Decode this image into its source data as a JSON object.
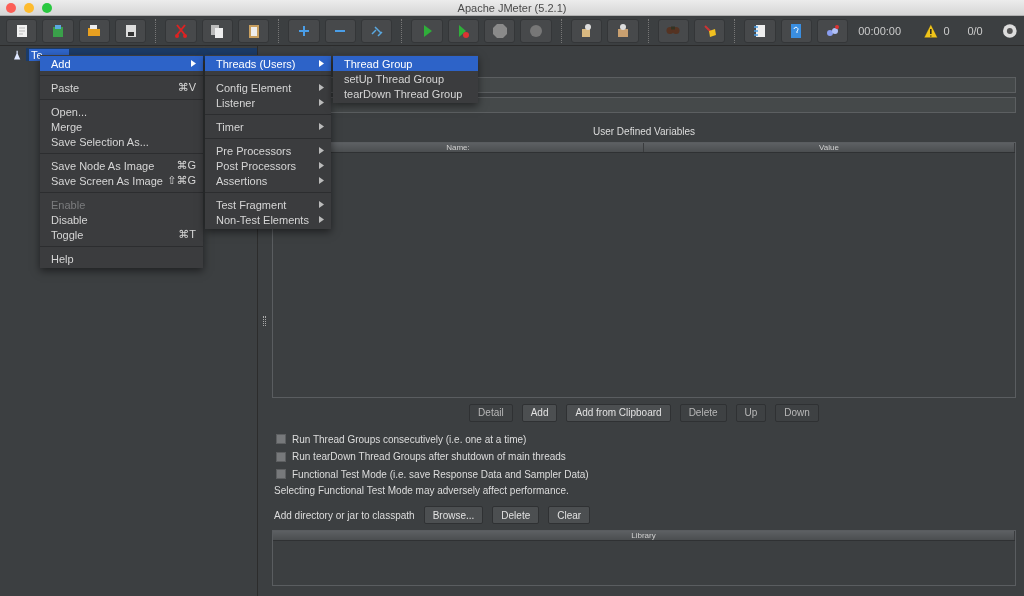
{
  "window": {
    "title": "Apache JMeter (5.2.1)"
  },
  "toolbar": {
    "timer": "00:00:00",
    "warnings": "0",
    "threads": "0/0"
  },
  "tree": {
    "items": [
      {
        "label": "Te",
        "selected": true
      }
    ]
  },
  "context_menu": {
    "sections": [
      {
        "items": [
          {
            "label": "Add",
            "submenu": true,
            "selected": true,
            "disabled": false
          }
        ]
      },
      {
        "items": [
          {
            "label": "Paste",
            "shortcut": "⌘V",
            "submenu": false,
            "selected": false,
            "disabled": false
          }
        ]
      },
      {
        "items": [
          {
            "label": "Open...",
            "submenu": false,
            "selected": false,
            "disabled": false
          },
          {
            "label": "Merge",
            "submenu": false,
            "selected": false,
            "disabled": false
          },
          {
            "label": "Save Selection As...",
            "submenu": false,
            "selected": false,
            "disabled": false
          }
        ]
      },
      {
        "items": [
          {
            "label": "Save Node As Image",
            "shortcut": "⌘G",
            "submenu": false,
            "selected": false,
            "disabled": false
          },
          {
            "label": "Save Screen As Image",
            "shortcut": "⇧⌘G",
            "submenu": false,
            "selected": false,
            "disabled": false
          }
        ]
      },
      {
        "items": [
          {
            "label": "Enable",
            "submenu": false,
            "selected": false,
            "disabled": true
          },
          {
            "label": "Disable",
            "submenu": false,
            "selected": false,
            "disabled": false
          },
          {
            "label": "Toggle",
            "shortcut": "⌘T",
            "submenu": false,
            "selected": false,
            "disabled": false
          }
        ]
      },
      {
        "items": [
          {
            "label": "Help",
            "submenu": false,
            "selected": false,
            "disabled": false
          }
        ]
      }
    ]
  },
  "submenu": {
    "sections": [
      {
        "items": [
          {
            "label": "Threads (Users)",
            "submenu": true,
            "selected": true
          }
        ]
      },
      {
        "items": [
          {
            "label": "Config Element",
            "submenu": true,
            "selected": false
          },
          {
            "label": "Listener",
            "submenu": true,
            "selected": false
          }
        ]
      },
      {
        "items": [
          {
            "label": "Timer",
            "submenu": true,
            "selected": false
          }
        ]
      },
      {
        "items": [
          {
            "label": "Pre Processors",
            "submenu": true,
            "selected": false
          },
          {
            "label": "Post Processors",
            "submenu": true,
            "selected": false
          },
          {
            "label": "Assertions",
            "submenu": true,
            "selected": false
          }
        ]
      },
      {
        "items": [
          {
            "label": "Test Fragment",
            "submenu": true,
            "selected": false
          },
          {
            "label": "Non-Test Elements",
            "submenu": true,
            "selected": false
          }
        ]
      }
    ]
  },
  "submenu_2": {
    "sections": [
      {
        "items": [
          {
            "label": "Thread Group",
            "submenu": false,
            "selected": true
          },
          {
            "label": "setUp Thread Group",
            "submenu": false,
            "selected": false
          },
          {
            "label": "tearDown Thread Group",
            "submenu": false,
            "selected": false
          }
        ]
      }
    ]
  },
  "variables": {
    "title": "User Defined Variables",
    "columns": [
      "Name:",
      "Value"
    ],
    "buttons": [
      {
        "label": "Detail",
        "disabled": true
      },
      {
        "label": "Add",
        "disabled": false
      },
      {
        "label": "Add from Clipboard",
        "disabled": false
      },
      {
        "label": "Delete",
        "disabled": true
      },
      {
        "label": "Up",
        "disabled": true
      },
      {
        "label": "Down",
        "disabled": true
      }
    ]
  },
  "options": [
    {
      "label": "Run Thread Groups consecutively (i.e. one at a time)",
      "checked": false
    },
    {
      "label": "Run tearDown Thread Groups after shutdown of main threads",
      "checked": false
    },
    {
      "label": "Functional Test Mode (i.e. save Response Data and Sampler Data)",
      "checked": false
    }
  ],
  "note": "Selecting Functional Test Mode may adversely affect performance.",
  "classpath": {
    "label": "Add directory or jar to classpath",
    "buttons": [
      {
        "label": "Browse..."
      },
      {
        "label": "Delete"
      },
      {
        "label": "Clear"
      }
    ],
    "columns": [
      "Library"
    ]
  }
}
